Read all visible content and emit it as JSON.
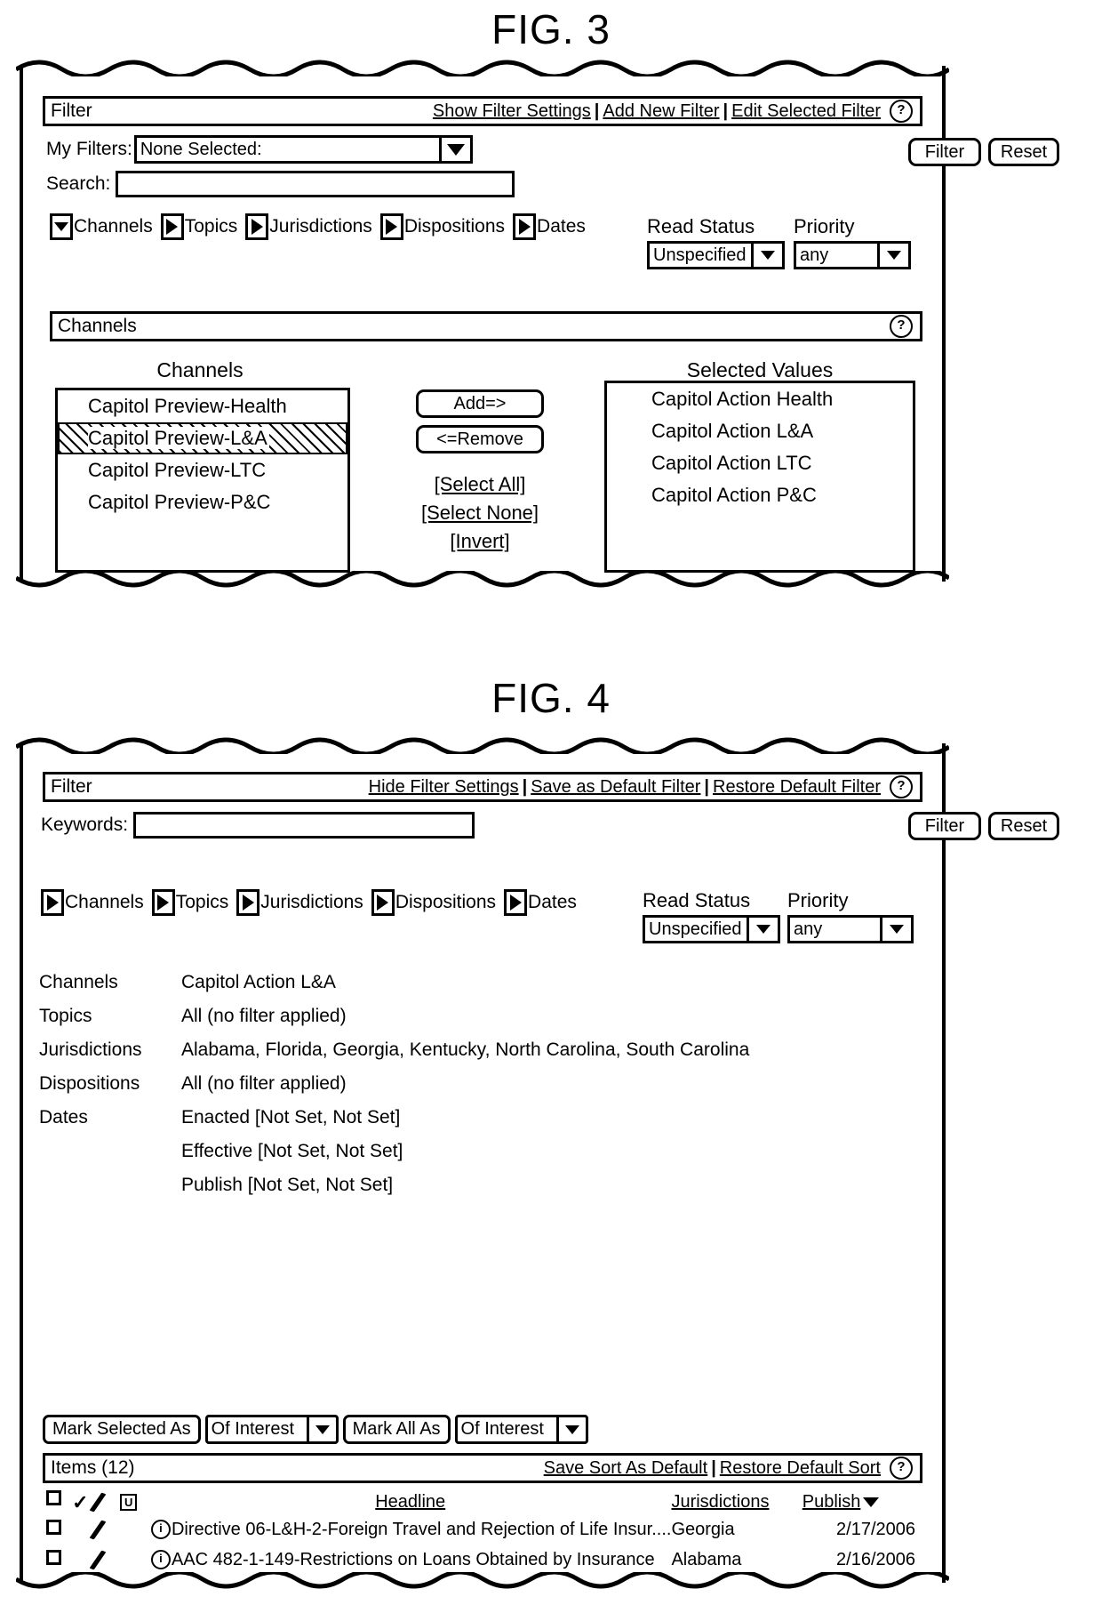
{
  "fig3": {
    "title": "FIG. 3",
    "filter_bar": {
      "title": "Filter",
      "links": [
        "Show Filter Settings",
        "Add New Filter",
        "Edit Selected Filter"
      ],
      "separator": "|",
      "help_icon": "?"
    },
    "my_filters_label": "My Filters:",
    "my_filters_value": "None Selected:",
    "search_label": "Search:",
    "search_value": "",
    "facets": [
      {
        "label": "Channels",
        "state": "expanded",
        "icon": "triangle-down-icon"
      },
      {
        "label": "Topics",
        "state": "collapsed",
        "icon": "triangle-right-icon"
      },
      {
        "label": "Jurisdictions",
        "state": "collapsed",
        "icon": "triangle-right-icon"
      },
      {
        "label": "Dispositions",
        "state": "collapsed",
        "icon": "triangle-right-icon"
      },
      {
        "label": "Dates",
        "state": "collapsed",
        "icon": "triangle-right-icon"
      }
    ],
    "read_status_label": "Read Status",
    "read_status_value": "Unspecified",
    "priority_label": "Priority",
    "priority_value": "any",
    "filter_button": "Filter",
    "reset_button": "Reset",
    "channels_bar": {
      "title": "Channels",
      "help_icon": "?"
    },
    "channels_col_head": "Channels",
    "channels_list": [
      {
        "label": "Capitol Preview-Health",
        "selected": false
      },
      {
        "label": "Capitol Preview-L&A",
        "selected": true
      },
      {
        "label": "Capitol Preview-LTC",
        "selected": false
      },
      {
        "label": "Capitol Preview-P&C",
        "selected": false
      }
    ],
    "add_button": "Add=>",
    "remove_button": "<=Remove",
    "select_all": "[Select All]",
    "select_none": "[Select None]",
    "invert": "[Invert]",
    "selected_values_head": "Selected Values",
    "selected_values": [
      "Capitol Action Health",
      "Capitol Action L&A",
      "Capitol Action LTC",
      "Capitol Action P&C"
    ]
  },
  "fig4": {
    "title": "FIG. 4",
    "filter_bar": {
      "title": "Filter",
      "links": [
        "Hide Filter Settings",
        "Save as Default Filter",
        "Restore Default Filter"
      ],
      "separator": "|",
      "help_icon": "?"
    },
    "keywords_label": "Keywords:",
    "keywords_value": "",
    "filter_button": "Filter",
    "reset_button": "Reset",
    "facets": [
      {
        "label": "Channels",
        "state": "collapsed",
        "icon": "triangle-right-icon"
      },
      {
        "label": "Topics",
        "state": "collapsed",
        "icon": "triangle-right-icon"
      },
      {
        "label": "Jurisdictions",
        "state": "collapsed",
        "icon": "triangle-right-icon"
      },
      {
        "label": "Dispositions",
        "state": "collapsed",
        "icon": "triangle-right-icon"
      },
      {
        "label": "Dates",
        "state": "collapsed",
        "icon": "triangle-right-icon"
      }
    ],
    "read_status_label": "Read Status",
    "read_status_value": "Unspecified",
    "priority_label": "Priority",
    "priority_value": "any",
    "summary": [
      {
        "key": "Channels",
        "values": [
          "Capitol Action L&A"
        ]
      },
      {
        "key": "Topics",
        "values": [
          "All (no filter applied)"
        ]
      },
      {
        "key": "Jurisdictions",
        "values": [
          "Alabama, Florida, Georgia, Kentucky, North Carolina, South Carolina"
        ]
      },
      {
        "key": "Dispositions",
        "values": [
          "All (no filter applied)"
        ]
      },
      {
        "key": "Dates",
        "values": [
          "Enacted [Not Set, Not Set]",
          "Effective [Not Set, Not Set]",
          "Publish [Not Set, Not Set]"
        ]
      }
    ],
    "mark_selected_button": "Mark Selected As",
    "mark_selected_value": "Of Interest",
    "mark_all_button": "Mark All As",
    "mark_all_value": "Of Interest",
    "items_bar": {
      "title": "Items (12)",
      "links": [
        "Save Sort As Default",
        "Restore Default Sort"
      ],
      "separator": "|",
      "help_icon": "?"
    },
    "items_table": {
      "headers": {
        "checkbox": "checkbox-icon",
        "check": "check-icon",
        "pencil": "pencil-icon",
        "unread": "U",
        "headline": "Headline",
        "jurisdictions": "Jurisdictions",
        "publish": "Publish"
      },
      "rows": [
        {
          "checked": false,
          "headline": "Directive 06-L&H-2-Foreign Travel and Rejection of Life Insur....",
          "jurisdiction": "Georgia",
          "publish": "2/17/2006"
        },
        {
          "checked": false,
          "headline": "AAC 482-1-149-Restrictions on Loans Obtained by Insurance",
          "jurisdiction": "Alabama",
          "publish": "2/16/2006"
        }
      ]
    }
  }
}
